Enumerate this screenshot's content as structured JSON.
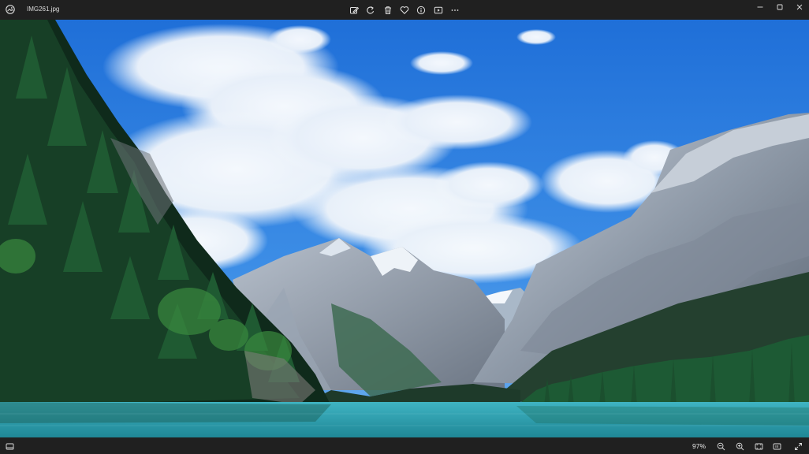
{
  "window": {
    "filename": "IMG261.jpg"
  },
  "toolbar": {
    "icons": [
      "edit-image-icon",
      "rotate-icon",
      "delete-icon",
      "favorite-icon",
      "file-info-icon",
      "slideshow-icon",
      "more-options-icon"
    ]
  },
  "window_controls": [
    "minimize-icon",
    "maximize-icon",
    "close-icon"
  ],
  "statusbar": {
    "zoom_label": "97%"
  },
  "colors": {
    "chrome_bg": "#202020",
    "icon": "#e0e0e0",
    "sky": "#2f7fe0",
    "water": "#2f9fb0"
  }
}
